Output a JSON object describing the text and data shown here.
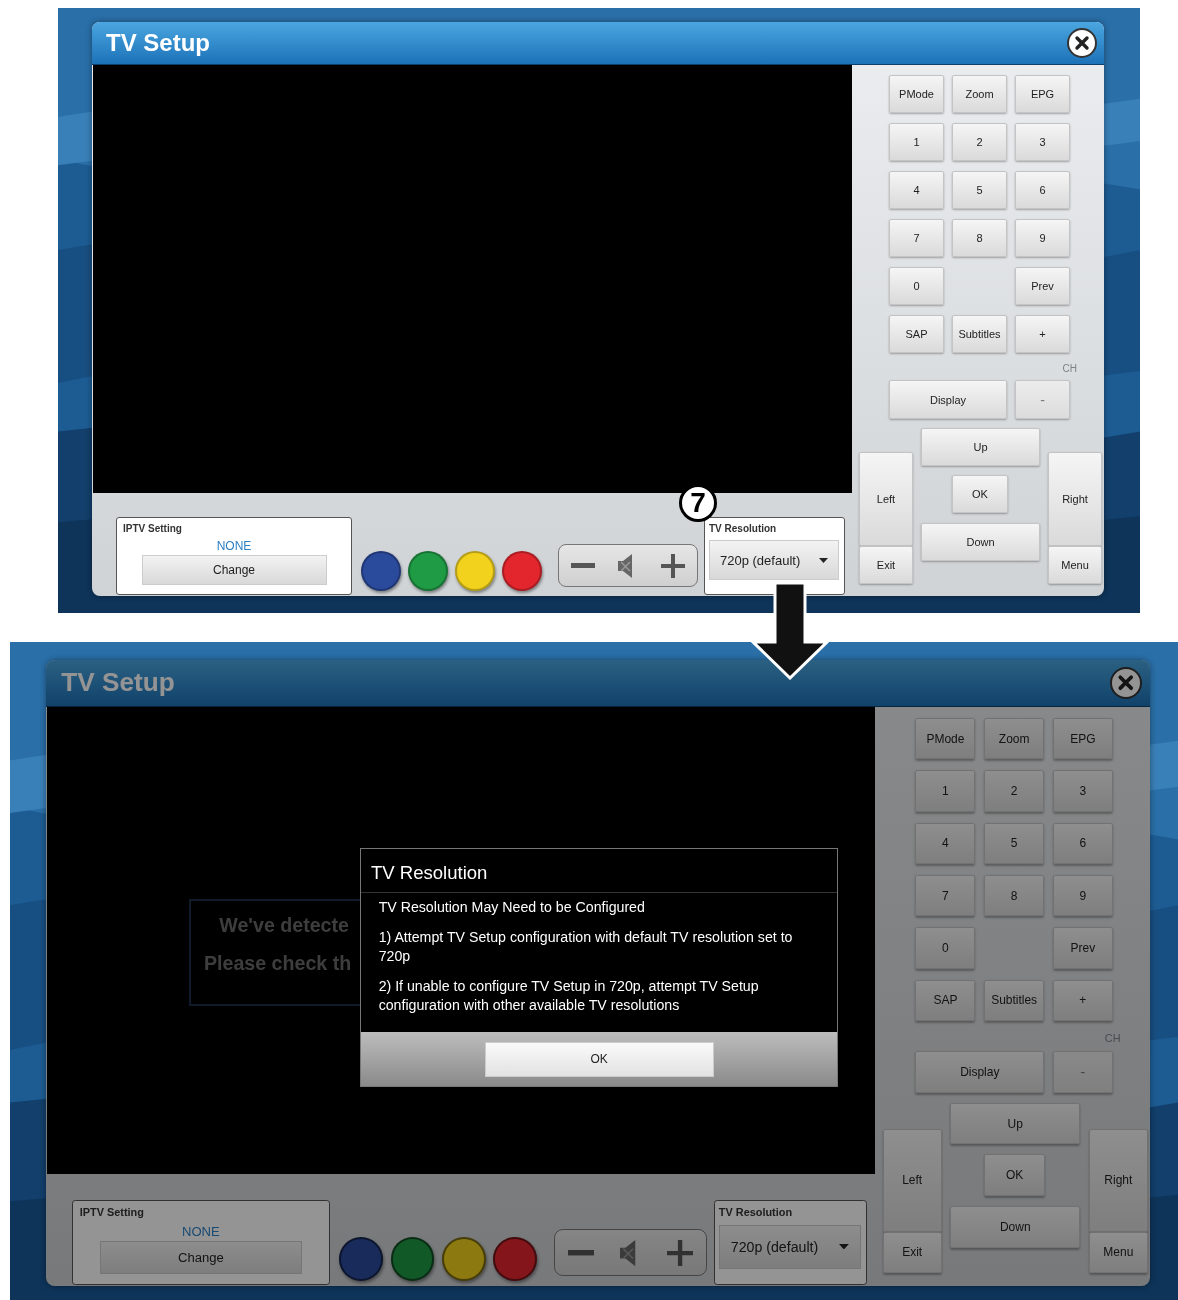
{
  "screens": [
    {
      "window": {
        "title": "TV Setup"
      },
      "keypad": {
        "rows": [
          [
            "PMode",
            "Zoom",
            "EPG"
          ],
          [
            "1",
            "2",
            "3"
          ],
          [
            "4",
            "5",
            "6"
          ],
          [
            "7",
            "8",
            "9"
          ],
          [
            "0",
            "",
            "Prev"
          ],
          [
            "SAP",
            "Subtitles",
            "+"
          ]
        ],
        "channel_label": "CH",
        "display_row": [
          {
            "label": "Display",
            "disabled": false
          },
          {
            "label": "-",
            "disabled": true
          }
        ],
        "dpad": {
          "up": "Up",
          "left": "Left",
          "ok": "OK",
          "right": "Right",
          "down": "Down",
          "exit": "Exit",
          "menu": "Menu"
        }
      },
      "iptv": {
        "label": "IPTV Setting",
        "value": "NONE",
        "button": "Change"
      },
      "color_buttons": [
        {
          "color": "#2a4a9c"
        },
        {
          "color": "#1f9a45"
        },
        {
          "color": "#f2d21c"
        },
        {
          "color": "#e3262e"
        }
      ],
      "resolution": {
        "label": "TV Resolution",
        "value": "720p (default)"
      },
      "callout": "7",
      "dimmed": false
    },
    {
      "window": {
        "title": "TV Setup"
      },
      "keypad": {
        "rows": [
          [
            "PMode",
            "Zoom",
            "EPG"
          ],
          [
            "1",
            "2",
            "3"
          ],
          [
            "4",
            "5",
            "6"
          ],
          [
            "7",
            "8",
            "9"
          ],
          [
            "0",
            "",
            "Prev"
          ],
          [
            "SAP",
            "Subtitles",
            "+"
          ]
        ],
        "channel_label": "CH",
        "display_row": [
          {
            "label": "Display",
            "disabled": false
          },
          {
            "label": "-",
            "disabled": true
          }
        ],
        "dpad": {
          "up": "Up",
          "left": "Left",
          "ok": "OK",
          "right": "Right",
          "down": "Down",
          "exit": "Exit",
          "menu": "Menu"
        }
      },
      "iptv": {
        "label": "IPTV Setting",
        "value": "NONE",
        "button": "Change"
      },
      "color_buttons": [
        {
          "color": "#182b5a"
        },
        {
          "color": "#125928"
        },
        {
          "color": "#8c7a10"
        },
        {
          "color": "#84161b"
        }
      ],
      "resolution": {
        "label": "TV Resolution",
        "value": "720p (default)"
      },
      "dimmed": true,
      "background_message": {
        "lines": [
          "We've detecte",
          "Please check th"
        ]
      },
      "dialog": {
        "title": "TV Resolution",
        "heading": "TV Resolution May Need to be Configured",
        "paragraphs": [
          "1) Attempt TV Setup configuration with default TV resolution set to 720p",
          "2) If unable to configure TV Setup in 720p, attempt TV Setup configuration with other available TV resolutions"
        ],
        "button": "OK"
      }
    }
  ]
}
